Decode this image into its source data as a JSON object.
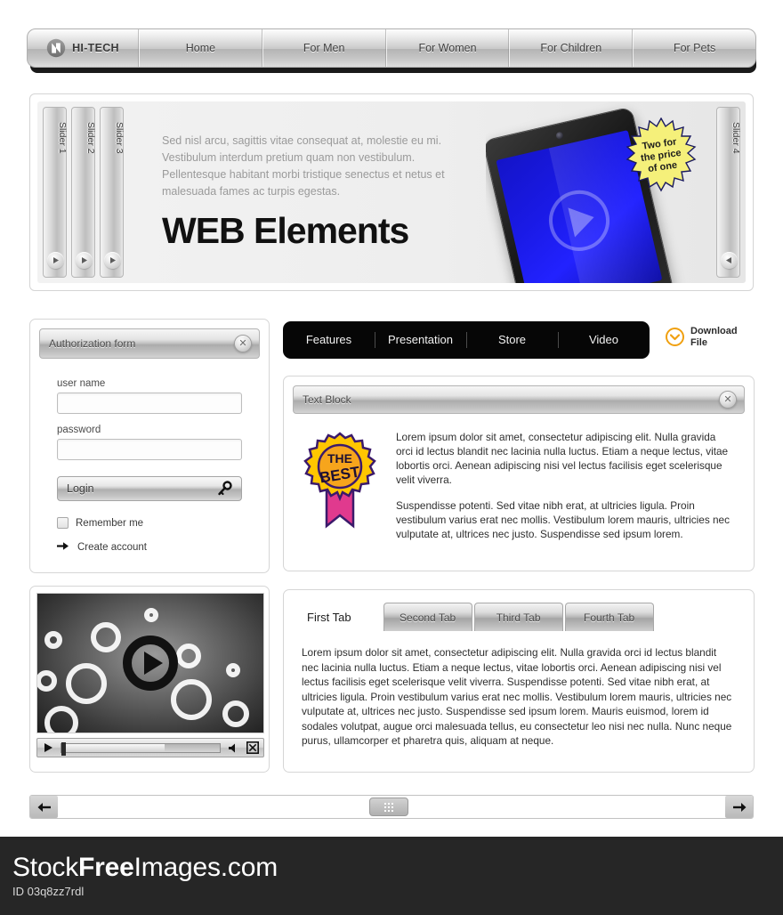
{
  "nav": {
    "logo": {
      "icon": "hitech-logo-icon",
      "label": "HI-TECH"
    },
    "items": [
      {
        "label": "Home"
      },
      {
        "label": "For Men"
      },
      {
        "label": "For Women"
      },
      {
        "label": "For Children"
      },
      {
        "label": "For Pets"
      }
    ]
  },
  "banner": {
    "slider_tabs": [
      {
        "label": "Slider 1"
      },
      {
        "label": "Slider 2"
      },
      {
        "label": "Slider 3"
      },
      {
        "label": "Slider 4"
      }
    ],
    "paragraph": "Sed nisl arcu, sagittis vitae consequat at, molestie eu mi. Vestibulum interdum pretium quam non vestibulum. Pellentesque habitant morbi tristique senectus et netus et malesuada fames ac turpis egestas.",
    "title_bold": "WEB",
    "title_rest": " Elements",
    "badge": {
      "line1": "Two for",
      "line2": "the price",
      "line3": "of one",
      "color": "#f5f07a"
    },
    "device": {
      "name": "tablet-device",
      "screen_color": "#1a1ae6"
    }
  },
  "auth_form": {
    "title": "Authorization form",
    "close_label": "✕",
    "username": {
      "label": "user name",
      "value": "",
      "placeholder": ""
    },
    "password": {
      "label": "password",
      "value": "",
      "placeholder": ""
    },
    "login_label": "Login",
    "remember_label": "Remember me",
    "remember_checked": false,
    "create_account_label": "Create account"
  },
  "dark_tabs": {
    "items": [
      {
        "label": "Features"
      },
      {
        "label": "Presentation"
      },
      {
        "label": "Store"
      },
      {
        "label": "Video"
      }
    ],
    "background": "#060606"
  },
  "download": {
    "line1": "Download",
    "line2": "File",
    "accent": "#f0a010"
  },
  "text_block": {
    "title": "Text Block",
    "close_label": "✕",
    "award": {
      "line1": "THE",
      "line2": "BEST",
      "color": "#ffc600"
    },
    "paragraphs": [
      "Lorem ipsum dolor sit amet, consectetur adipiscing elit. Nulla gravida orci id lectus blandit nec lacinia nulla luctus. Etiam a neque lectus, vitae lobortis orci. Aenean adipiscing nisi vel lectus facilisis eget scelerisque velit viverra.",
      "Suspendisse potenti. Sed vitae nibh erat, at ultricies ligula. Proin vestibulum varius erat nec mollis. Vestibulum lorem mauris, ultricies nec vulputate at, ultrices nec justo. Suspendisse sed ipsum lorem."
    ]
  },
  "video_player": {
    "play_label": "play-button",
    "progress_percent": 65,
    "controls": {
      "play": "play-icon",
      "volume": "volume-icon",
      "fullscreen": "fullscreen-icon"
    }
  },
  "tabs_panel": {
    "tabs": [
      {
        "label": "First Tab",
        "active": true
      },
      {
        "label": "Second Tab",
        "active": false
      },
      {
        "label": "Third Tab",
        "active": false
      },
      {
        "label": "Fourth Tab",
        "active": false
      }
    ],
    "content": "Lorem ipsum dolor sit amet, consectetur adipiscing elit. Nulla gravida orci id lectus blandit nec lacinia nulla luctus. Etiam a neque lectus, vitae lobortis orci. Aenean adipiscing nisi vel lectus facilisis eget scelerisque velit viverra. Suspendisse potenti. Sed vitae nibh erat, at ultricies ligula. Proin vestibulum varius erat nec mollis. Vestibulum lorem mauris, ultricies nec vulputate at, ultrices nec justo. Suspendisse sed ipsum lorem. Mauris euismod, lorem id sodales volutpat, augue orci malesuada tellus, eu consectetur leo nisi nec nulla. Nunc neque purus, ullamcorper et pharetra quis, aliquam at neque."
  },
  "scrollbar": {
    "left_arrow": "←",
    "right_arrow": "→",
    "thumb_position_percent": 50
  },
  "footer": {
    "brand_part1": "Stock",
    "brand_part2": "Free",
    "brand_part3": "Images.com",
    "id": "ID 03q8zz7rdl"
  }
}
